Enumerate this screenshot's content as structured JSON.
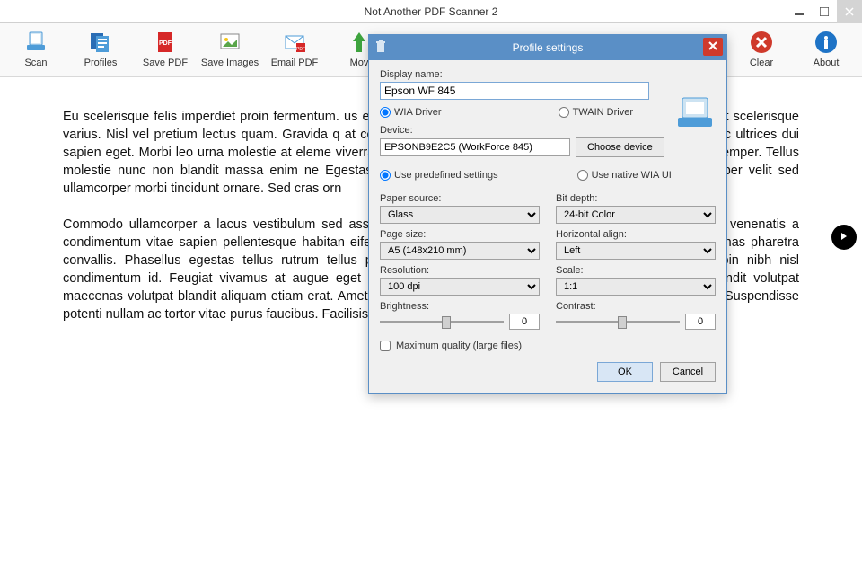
{
  "window": {
    "title": "Not Another PDF Scanner 2"
  },
  "toolbar": {
    "scan": "Scan",
    "profiles": "Profiles",
    "save_pdf": "Save PDF",
    "save_images": "Save Images",
    "email_pdf": "Email PDF",
    "move": "Mov",
    "clear": "Clear",
    "about": "About"
  },
  "doc": {
    "p1": "Eu scelerisque felis imperdiet proin fermentum.                                                                                             us est. Turpis egestas maecenas pharetra convallis posuere m                                                                                               at scelerisque varius. Nisl vel pretium lectus quam. Gravida q                                                                                              at consequat mauris nunc congue nisi. Nunc congue nisi vitae                                                                                           ec ultrices dui sapien eget. Morbi leo urna molestie at eleme                                                                                                 viverra nam libero. Cras ornare arcu dui vivamus. Duis ut d                                                                                                 cras semper. Tellus molestie nunc non blandit massa enim ne                                                                                           Egestas dui id ornare arcu odio ut. A arcu cursus vitae congue                                                                                             rper velit sed ullamcorper morbi tincidunt ornare. Sed cras orn",
    "p2": "Commodo ullamcorper a lacus vestibulum sed                                                                                                    assa placerat duis ultricies. Duis ut diam quam nulla porttito                                                                                               l venenatis a condimentum vitae sapien pellentesque habitan                                                                                                eifend donec pretium vulputate sapien. Non consectetur a er                                                                                                enas pharetra convallis. Phasellus egestas tellus rutrum tellus pellentesque eu tincidunt. Nibh tortor id aliquet lectus proin nibh nisl condimentum id. Feugiat vivamus at augue eget arcu. Aliquet sagittis id consectetur purus ut faucibus. Blandit volutpat maecenas volutpat blandit aliquam etiam erat. Amet consectetur adipiscing elit ut aliquam purus sit amet luctus. Suspendisse potenti nullam ac tortor vitae purus faucibus. Facilisis leo vel fringilla est."
  },
  "dialog": {
    "title": "Profile settings",
    "display_name_label": "Display name:",
    "display_name_value": "Epson WF 845",
    "driver_wia": "WIA Driver",
    "driver_twain": "TWAIN Driver",
    "device_label": "Device:",
    "device_value": "EPSONB9E2C5 (WorkForce 845)",
    "choose_device": "Choose device",
    "predef": "Use predefined settings",
    "native": "Use native WIA UI",
    "paper_source_label": "Paper source:",
    "paper_source_value": "Glass",
    "page_size_label": "Page size:",
    "page_size_value": "A5 (148x210 mm)",
    "resolution_label": "Resolution:",
    "resolution_value": "100 dpi",
    "brightness_label": "Brightness:",
    "brightness_value": "0",
    "bit_depth_label": "Bit depth:",
    "bit_depth_value": "24-bit Color",
    "halign_label": "Horizontal align:",
    "halign_value": "Left",
    "scale_label": "Scale:",
    "scale_value": "1:1",
    "contrast_label": "Contrast:",
    "contrast_value": "0",
    "max_quality": "Maximum quality (large files)",
    "ok": "OK",
    "cancel": "Cancel"
  }
}
